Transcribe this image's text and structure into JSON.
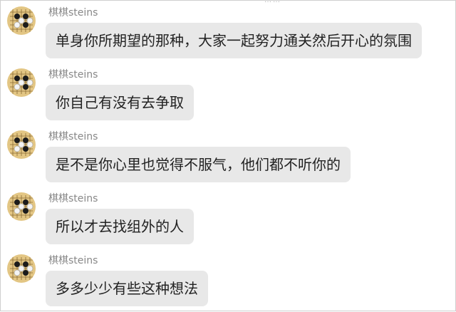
{
  "top_fragment": "……",
  "messages": [
    {
      "sender": "棋棋steins",
      "text": "单身你所期望的那种，大家一起努力通关然后开心的氛围",
      "avatar": "go-board-avatar"
    },
    {
      "sender": "棋棋steins",
      "text": "你自己有没有去争取",
      "avatar": "go-board-avatar"
    },
    {
      "sender": "棋棋steins",
      "text": "是不是你心里也觉得不服气，他们都不听你的",
      "avatar": "go-board-avatar"
    },
    {
      "sender": "棋棋steins",
      "text": "所以才去找组外的人",
      "avatar": "go-board-avatar"
    },
    {
      "sender": "棋棋steins",
      "text": "多多少少有些这种想法",
      "avatar": "go-board-avatar"
    }
  ]
}
